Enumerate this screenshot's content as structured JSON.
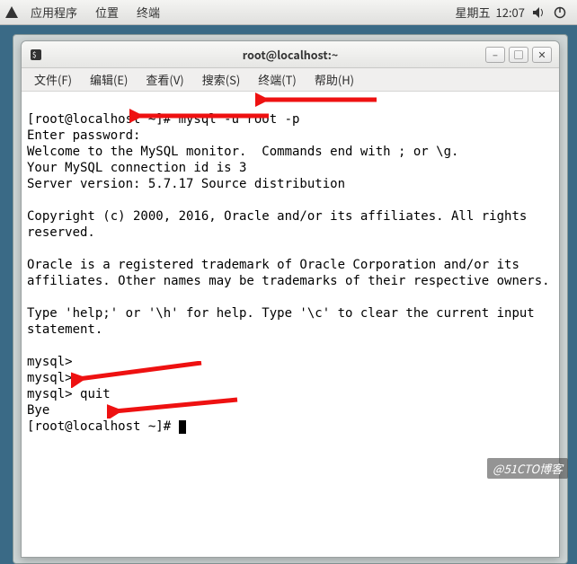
{
  "panel": {
    "apps": "应用程序",
    "places": "位置",
    "terminal": "终端",
    "day": "星期五",
    "time": "12:07"
  },
  "window": {
    "title": "root@localhost:~",
    "min": "–",
    "max": "□",
    "close": "✕"
  },
  "menubar": {
    "file": "文件(F)",
    "edit": "编辑(E)",
    "view": "查看(V)",
    "search": "搜索(S)",
    "terminal": "终端(T)",
    "help": "帮助(H)"
  },
  "term": {
    "l1a": "[root@localhost ~]# ",
    "l1b": "mysql -u root -p",
    "l2": "Enter password:",
    "l3": "Welcome to the MySQL monitor.  Commands end with ; or \\g.",
    "l4": "Your MySQL connection id is 3",
    "l5": "Server version: 5.7.17 Source distribution",
    "l6": "Copyright (c) 2000, 2016, Oracle and/or its affiliates. All rights reserved.",
    "l7": "Oracle is a registered trademark of Oracle Corporation and/or its affiliates. Other names may be trademarks of their respective owners.",
    "l8": "Type 'help;' or '\\h' for help. Type '\\c' to clear the current input statement.",
    "p1": "mysql> ",
    "p2": "mysql> ",
    "p3a": "mysql> ",
    "p3b": "quit",
    "bye": "Bye",
    "lasta": "[root@localhost ~]# "
  },
  "watermark": "@51CTO博客"
}
